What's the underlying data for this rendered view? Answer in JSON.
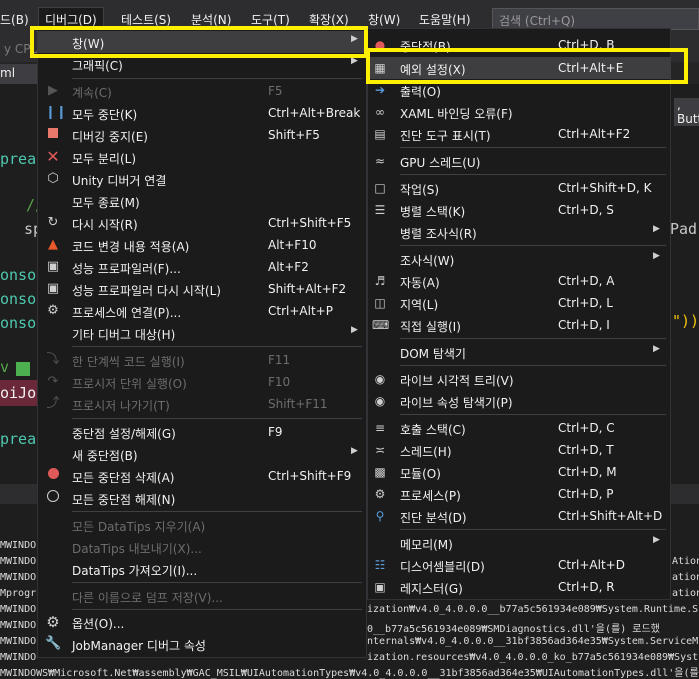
{
  "menubar": {
    "items": [
      {
        "label": "드(B)"
      },
      {
        "label": "디버그(D)"
      },
      {
        "label": "테스트(S)"
      },
      {
        "label": "분석(N)"
      },
      {
        "label": "도구(T)"
      },
      {
        "label": "확장(X)"
      },
      {
        "label": "창(W)"
      },
      {
        "label": "도움말(H)"
      }
    ],
    "search_placeholder": "검색 (Ctrl+Q)"
  },
  "toolbar": {
    "cpu_label": "y CPU"
  },
  "tab": {
    "label": "ml"
  },
  "editor": {
    "fragments": [
      "preac",
      "//",
      "sp",
      "onso",
      "onso",
      "onso",
      "v",
      "oiJob",
      "preac"
    ]
  },
  "right_fragments": [
    ", Butt",
    "Pad",
    "\"))"
  ],
  "debug_menu": {
    "items": [
      {
        "label": "창(W)",
        "shortcut": "",
        "submenu": true,
        "selected": true,
        "disabled": false,
        "icon": ""
      },
      {
        "label": "그래픽(C)",
        "shortcut": "",
        "submenu": true,
        "disabled": false,
        "icon": ""
      },
      {
        "label": "계속(C)",
        "shortcut": "F5",
        "disabled": true,
        "icon": "play-icon"
      },
      {
        "label": "모두 중단(K)",
        "shortcut": "Ctrl+Alt+Break",
        "disabled": false,
        "icon": "pause-icon"
      },
      {
        "label": "디버깅 중지(E)",
        "shortcut": "Shift+F5",
        "disabled": false,
        "icon": "stop-icon"
      },
      {
        "label": "모두 분리(L)",
        "shortcut": "",
        "disabled": false,
        "icon": "detach-x-icon"
      },
      {
        "label": "Unity 디버거 연결",
        "shortcut": "",
        "disabled": false,
        "icon": "unity-cube-icon"
      },
      {
        "label": "모두 종료(M)",
        "shortcut": "",
        "disabled": false,
        "icon": ""
      },
      {
        "label": "다시 시작(R)",
        "shortcut": "Ctrl+Shift+F5",
        "disabled": false,
        "icon": "restart-icon"
      },
      {
        "label": "코드 변경 내용 적용(A)",
        "shortcut": "Alt+F10",
        "disabled": false,
        "icon": "hot-reload-flame-icon"
      },
      {
        "label": "성능 프로파일러(F)...",
        "shortcut": "Alt+F2",
        "disabled": false,
        "icon": "profiler-icon"
      },
      {
        "label": "성능 프로파일러 다시 시작(L)",
        "shortcut": "Shift+Alt+F2",
        "disabled": false,
        "icon": "profiler-restart-icon"
      },
      {
        "label": "프로세스에 연결(P)...",
        "shortcut": "Ctrl+Alt+P",
        "disabled": false,
        "icon": "attach-process-icon"
      },
      {
        "label": "기타 디버그 대상(H)",
        "shortcut": "",
        "submenu": true,
        "disabled": false,
        "icon": ""
      },
      {
        "label": "한 단계씩 코드 실행(I)",
        "shortcut": "F11",
        "disabled": true,
        "icon": "step-into-icon"
      },
      {
        "label": "프로시저 단위 실행(O)",
        "shortcut": "F10",
        "disabled": true,
        "icon": "step-over-icon"
      },
      {
        "label": "프로시저 나가기(T)",
        "shortcut": "Shift+F11",
        "disabled": true,
        "icon": "step-out-icon"
      },
      {
        "label": "중단점 설정/해제(G)",
        "shortcut": "F9",
        "disabled": false,
        "icon": ""
      },
      {
        "label": "새 중단점(B)",
        "shortcut": "",
        "submenu": true,
        "disabled": false,
        "icon": ""
      },
      {
        "label": "모든 중단점 삭제(A)",
        "shortcut": "Ctrl+Shift+F9",
        "disabled": false,
        "icon": "delete-breakpoints-icon"
      },
      {
        "label": "모든 중단점 해제(N)",
        "shortcut": "",
        "disabled": false,
        "icon": "disable-breakpoints-icon"
      },
      {
        "label": "모든 DataTips 지우기(A)",
        "shortcut": "",
        "disabled": true,
        "icon": ""
      },
      {
        "label": "DataTips 내보내기(X)...",
        "shortcut": "",
        "disabled": true,
        "icon": ""
      },
      {
        "label": "DataTips 가져오기(I)...",
        "shortcut": "",
        "disabled": false,
        "icon": ""
      },
      {
        "label": "다른 이름으로 덤프 저장(V)...",
        "shortcut": "",
        "disabled": true,
        "icon": ""
      },
      {
        "label": "옵션(O)...",
        "shortcut": "",
        "disabled": false,
        "icon": "gear-icon"
      },
      {
        "label": "JobManager 디버그 속성",
        "shortcut": "",
        "disabled": false,
        "icon": "wrench-icon"
      }
    ]
  },
  "window_menu": {
    "items": [
      {
        "label": "중단점(B)",
        "shortcut": "Ctrl+D, B",
        "icon": "breakpoint-window-icon"
      },
      {
        "label": "예외 설정(X)",
        "shortcut": "Ctrl+Alt+E",
        "icon": "exception-settings-icon",
        "hovered": true
      },
      {
        "label": "출력(O)",
        "shortcut": "",
        "icon": "output-icon"
      },
      {
        "label": "XAML 바인딩 오류(F)",
        "shortcut": "",
        "icon": "xaml-binding-icon"
      },
      {
        "label": "진단 도구 표시(T)",
        "shortcut": "Ctrl+Alt+F2",
        "icon": "diagnostic-tools-icon"
      },
      {
        "label": "GPU 스레드(U)",
        "shortcut": "",
        "icon": "gpu-threads-icon"
      },
      {
        "label": "작업(S)",
        "shortcut": "Ctrl+Shift+D, K",
        "icon": "tasks-icon"
      },
      {
        "label": "병렬 스택(K)",
        "shortcut": "Ctrl+D, S",
        "icon": "parallel-stacks-icon"
      },
      {
        "label": "병렬 조사식(R)",
        "shortcut": "",
        "icon": "",
        "submenu": true
      },
      {
        "label": "조사식(W)",
        "shortcut": "",
        "icon": "",
        "submenu": true
      },
      {
        "label": "자동(A)",
        "shortcut": "Ctrl+D, A",
        "icon": "autos-icon"
      },
      {
        "label": "지역(L)",
        "shortcut": "Ctrl+D, L",
        "icon": "locals-icon"
      },
      {
        "label": "직접 실행(I)",
        "shortcut": "Ctrl+D, I",
        "icon": "immediate-icon"
      },
      {
        "label": "DOM 탐색기",
        "shortcut": "",
        "icon": "",
        "submenu": true
      },
      {
        "label": "라이브 시각적 트리(V)",
        "shortcut": "",
        "icon": "camera-icon"
      },
      {
        "label": "라이브 속성 탐색기(P)",
        "shortcut": "",
        "icon": "camera-icon"
      },
      {
        "label": "호출 스택(C)",
        "shortcut": "Ctrl+D, C",
        "icon": "call-stack-icon"
      },
      {
        "label": "스레드(H)",
        "shortcut": "Ctrl+D, T",
        "icon": "threads-icon"
      },
      {
        "label": "모듈(O)",
        "shortcut": "Ctrl+D, M",
        "icon": "modules-icon"
      },
      {
        "label": "프로세스(P)",
        "shortcut": "Ctrl+D, P",
        "icon": "processes-icon"
      },
      {
        "label": "진단 분석(D)",
        "shortcut": "Ctrl+Shift+Alt+D",
        "icon": "diagnostic-analysis-icon"
      },
      {
        "label": "메모리(M)",
        "shortcut": "",
        "icon": "",
        "submenu": true
      },
      {
        "label": "디스어셈블리(D)",
        "shortcut": "Ctrl+Alt+D",
        "icon": "disassembly-icon"
      },
      {
        "label": "레지스터(G)",
        "shortcut": "Ctrl+D, R",
        "icon": "registers-icon"
      }
    ]
  },
  "output_lines": [
    "",
    "MWINDOWS",
    "MWINDOWS",
    "MWINDOWS",
    "Mprogra",
    "MWINDOWS",
    "MWINDOWS",
    "MWINDOWS",
    "MWINDOWS"
  ],
  "output_right": [
    "Ation",
    "ationF",
    "ationCore",
    "ization₩v4.0_4.0.0.0__b77a5c561934e089₩System.Runtime.S",
    "0__b77a5c561934e089₩SMDiagnostics.dll'을(를) 로드했",
    "nternals₩v4.0_4.0.0.0__31bf3856ad364e35₩System.ServiceM",
    "ization.resources₩v4.0_4.0.0.0_ko_b77a5c561934e089₩Syst",
    "MWINDOWS₩Microsoft.Net₩assembly₩GAC_MSIL₩UIAutomationTypes₩v4.0_4.0.0.0__31bf3856ad364e35₩UIAutomationTypes.dll'을(를"
  ]
}
